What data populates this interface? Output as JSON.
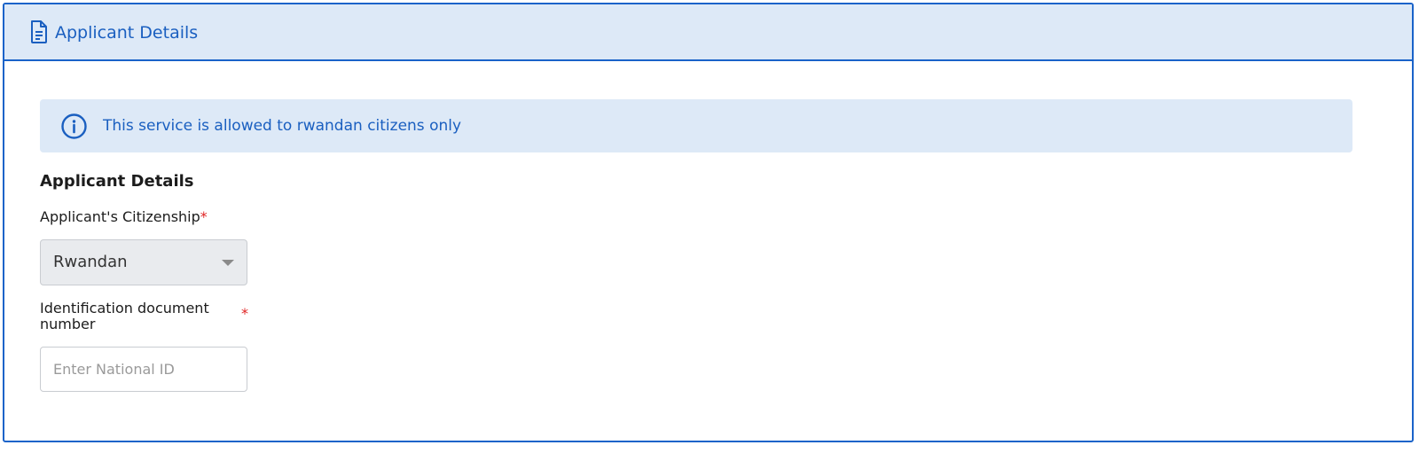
{
  "header": {
    "title": "Applicant Details",
    "icon": "document-icon",
    "accent_color": "#1a63c9"
  },
  "notice": {
    "icon": "info-icon",
    "text": "This service is allowed to rwandan citizens only"
  },
  "form": {
    "section_title": "Applicant Details",
    "citizenship": {
      "label": "Applicant's Citizenship",
      "required_mark": "*",
      "selected_value": "Rwandan"
    },
    "identification": {
      "label": "Identification document number",
      "required_mark": "*",
      "value": "",
      "placeholder": "Enter National ID"
    }
  }
}
